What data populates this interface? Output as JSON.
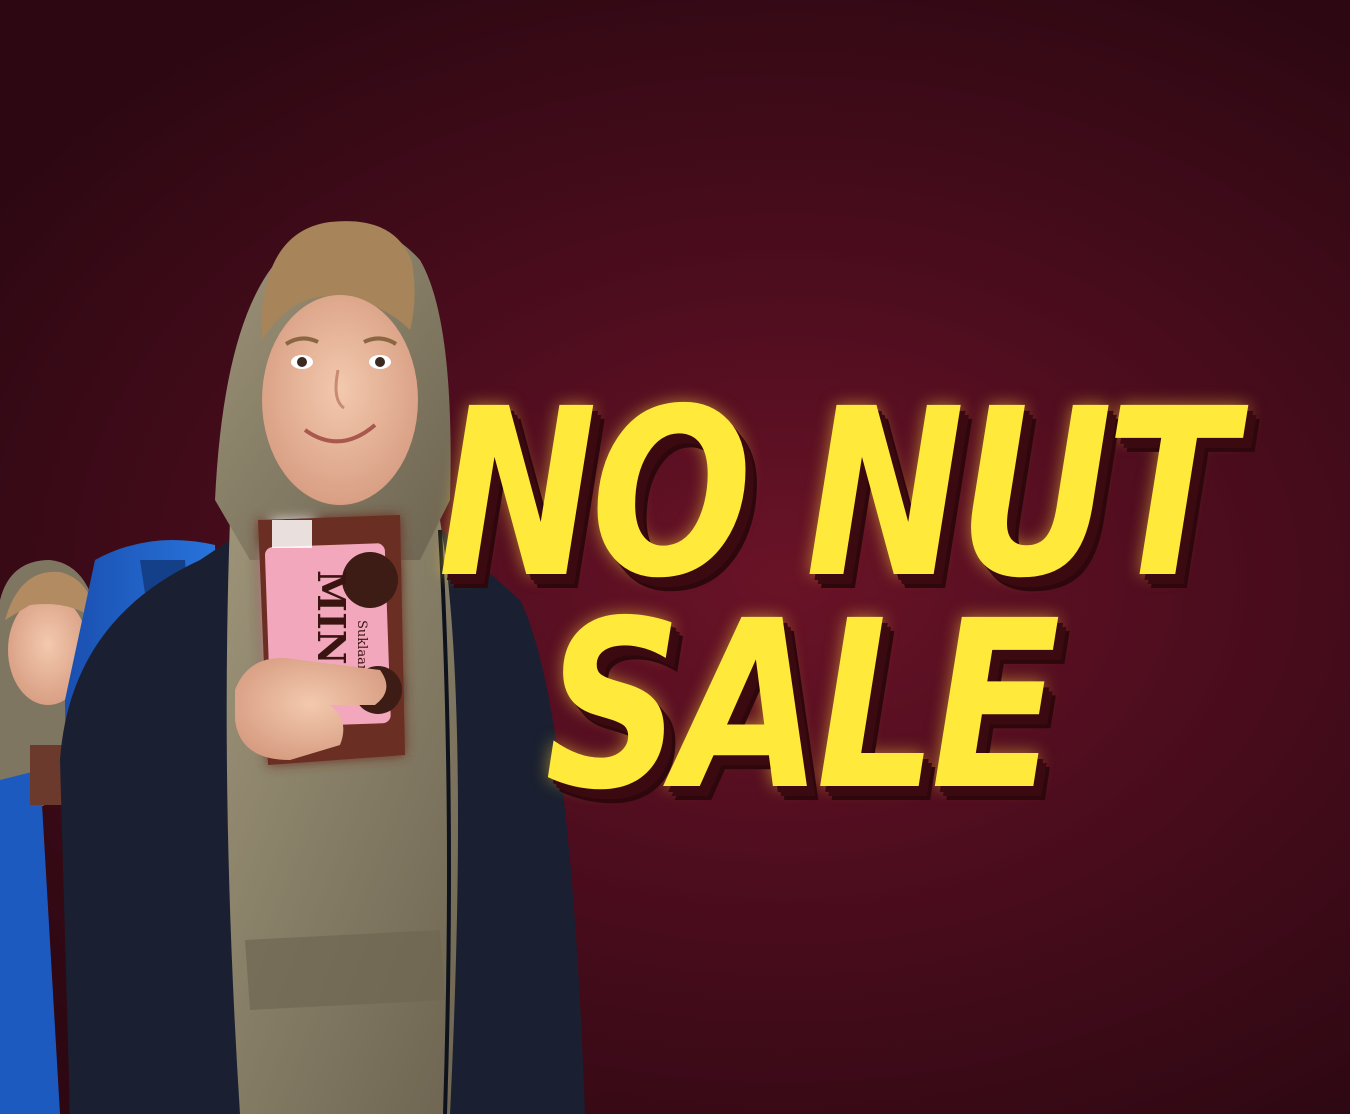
{
  "headline": {
    "line1": "NO NUT",
    "line2": "SALE"
  },
  "product": {
    "brand_text": "MINO",
    "sub_text": "Suklaanen"
  },
  "colors": {
    "background": "#5a0f22",
    "headline": "#ffe93b",
    "headline_shadow": "#3a0a10",
    "hoodie": "#8a8068",
    "jacket": "#1b2233",
    "backpack": "#1c62c8",
    "box": "#6b2f24",
    "box_label": "#f2a7bd"
  }
}
